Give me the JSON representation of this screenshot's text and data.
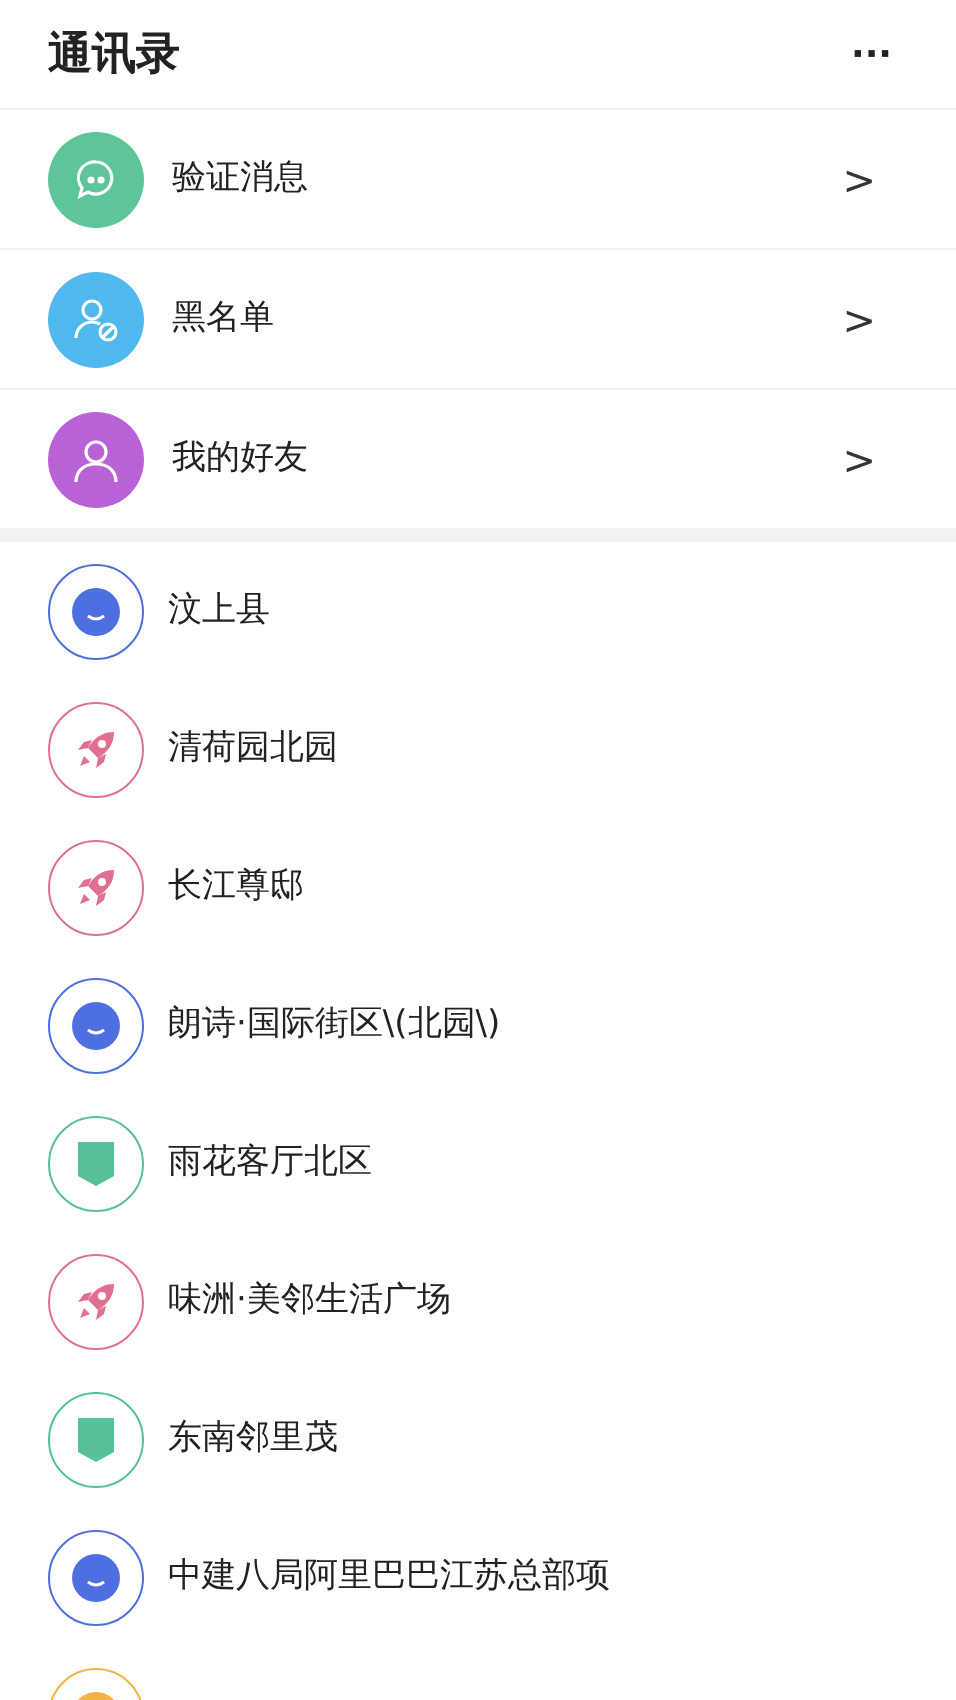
{
  "header": {
    "title": "通讯录",
    "more": "···"
  },
  "menu": [
    {
      "label": "验证消息",
      "kind": "chat",
      "color": "#5ec59b",
      "arrow": ">"
    },
    {
      "label": "黑名单",
      "kind": "blocked",
      "color": "#4fb8ef",
      "arrow": ">"
    },
    {
      "label": "我的好友",
      "kind": "person",
      "color": "#b862d6",
      "arrow": ">"
    }
  ],
  "contacts": [
    {
      "name": "汶上县",
      "kind": "smile",
      "color": "#4d6fe0"
    },
    {
      "name": "清荷园北园",
      "kind": "rocket",
      "color": "#e0708f"
    },
    {
      "name": "长江尊邸",
      "kind": "rocket",
      "color": "#e0708f"
    },
    {
      "name": "朗诗·国际街区\\(北园\\)",
      "kind": "smile",
      "color": "#4d6fe0"
    },
    {
      "name": "雨花客厅北区",
      "kind": "shield",
      "color": "#56c196"
    },
    {
      "name": "味洲·美邻生活广场",
      "kind": "rocket",
      "color": "#e0708f"
    },
    {
      "name": "东南邻里茂",
      "kind": "shield",
      "color": "#56c196"
    },
    {
      "name": "中建八局阿里巴巴江苏总部项",
      "kind": "smile",
      "color": "#4d6fe0"
    },
    {
      "kind": "dot",
      "color": "#f2b443"
    }
  ]
}
